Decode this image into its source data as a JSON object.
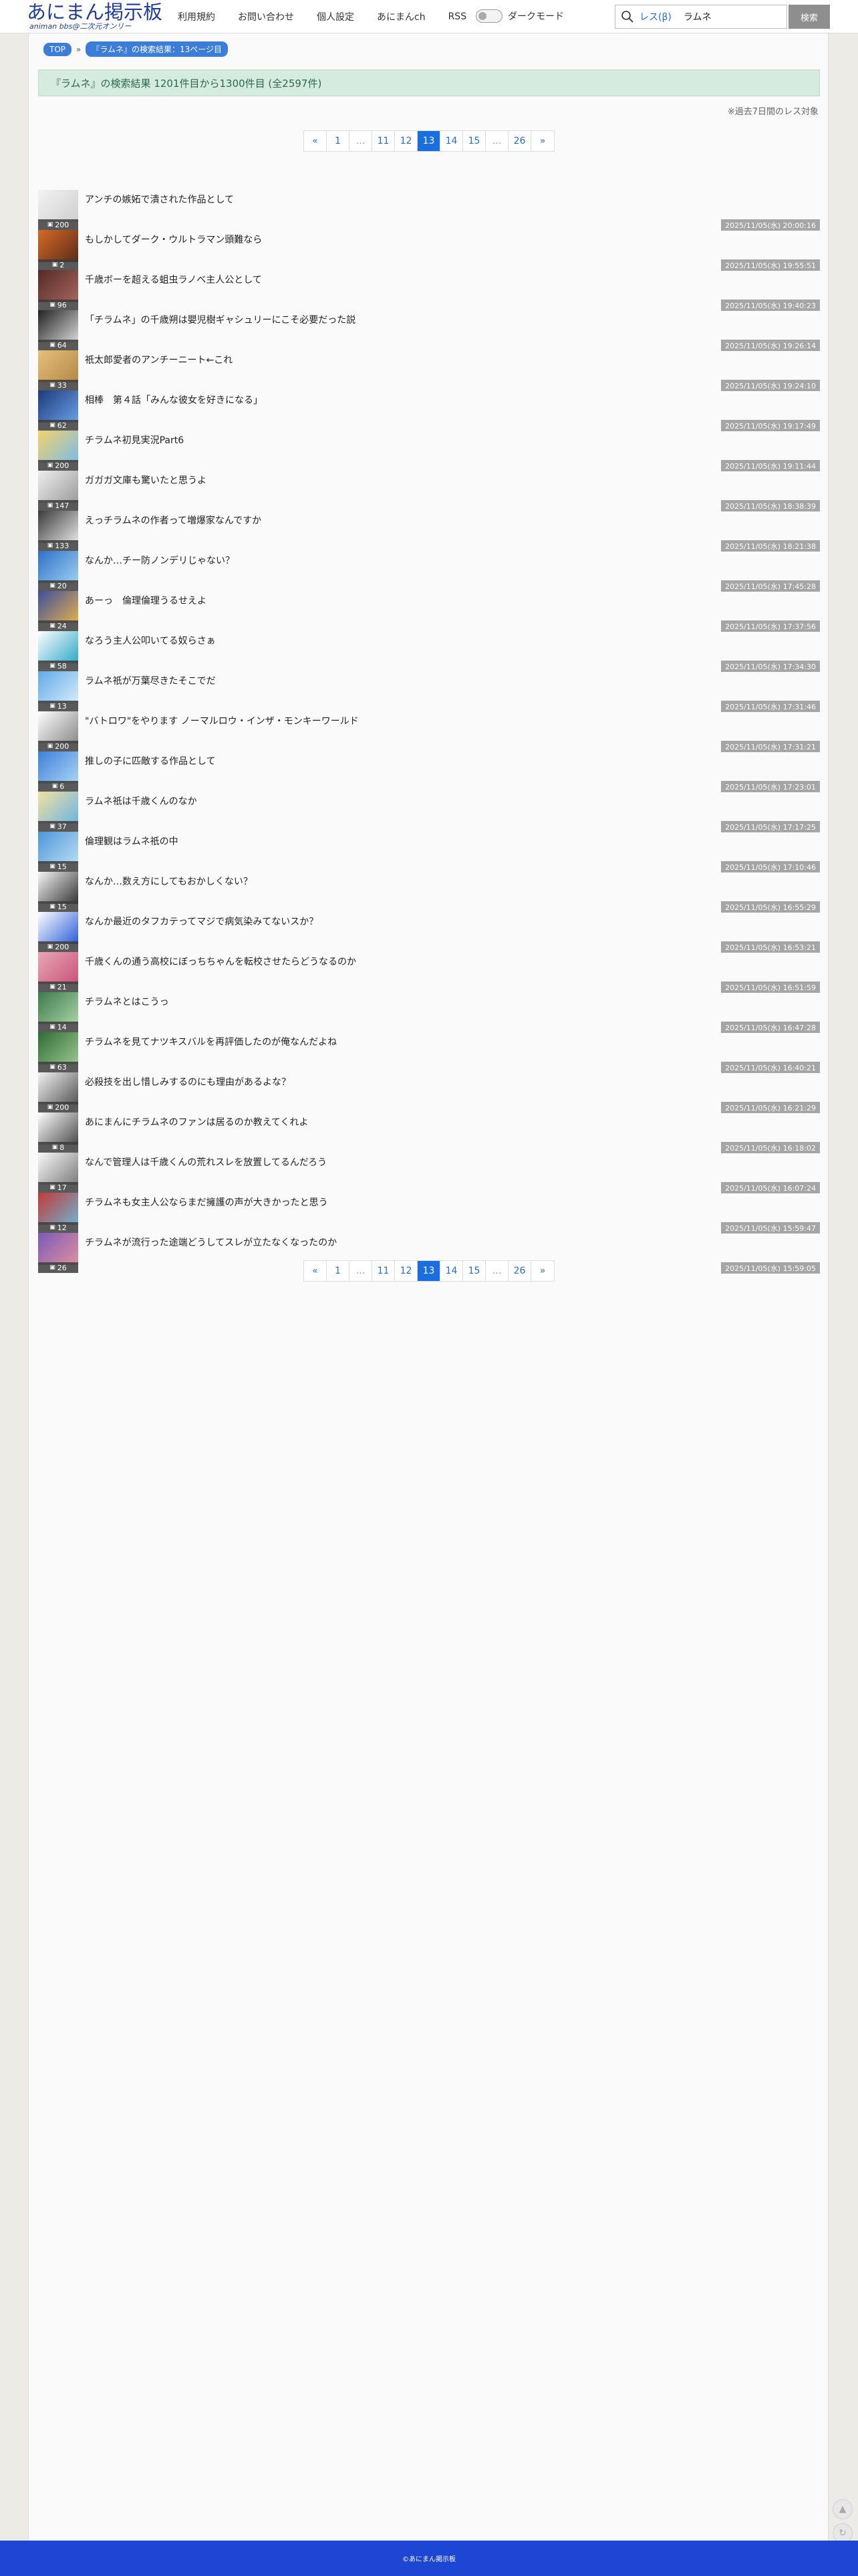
{
  "header": {
    "logo_main": "あにまん掲示板",
    "logo_sub": "animan bbs@二次元オンリー",
    "nav": [
      "利用規約",
      "お問い合わせ",
      "個人設定",
      "あにまんch",
      "RSS"
    ],
    "dark_mode_label": "ダークモード",
    "search_scope": "レス(β)",
    "search_value": "ラムネ",
    "search_button": "検索"
  },
  "breadcrumb": {
    "top": "TOP",
    "separator": "»",
    "current": "『ラムネ』の検索結果：13ページ目"
  },
  "result_banner": "『ラムネ』の検索結果 1201件目から1300件目 (全2597件)",
  "note": "※過去7日間のレス対象",
  "pager": {
    "prev": "«",
    "next": "»",
    "pages": [
      "1",
      "...",
      "11",
      "12",
      "13",
      "14",
      "15",
      "...",
      "26"
    ],
    "active": "13"
  },
  "threads": [
    {
      "title": "アンチの嫉妬で潰された作品として",
      "count": "200",
      "date": "2025/11/05(水) 20:00:16",
      "colors": [
        "#f2f2f2",
        "#cfcfcf"
      ]
    },
    {
      "title": "もしかしてダーク・ウルトラマン頭難なら",
      "count": "2",
      "date": "2025/11/05(水) 19:55:51",
      "colors": [
        "#d66a28",
        "#5a2b17"
      ]
    },
    {
      "title": "千歳ボーを超える蛆虫ラノベ主人公として",
      "count": "96",
      "date": "2025/11/05(水) 19:40:23",
      "colors": [
        "#552a27",
        "#a6655b"
      ]
    },
    {
      "title": "「チラムネ」の千歳朔は嬰児樹ギャシュリーにこそ必要だった説",
      "count": "64",
      "date": "2025/11/05(水) 19:26:14",
      "colors": [
        "#222222",
        "#d8d8d8"
      ]
    },
    {
      "title": "祇太郎愛者のアンチーニート←これ",
      "count": "33",
      "date": "2025/11/05(水) 19:24:10",
      "colors": [
        "#e5c07a",
        "#b48846"
      ]
    },
    {
      "title": "相棒　第４話「みんな彼女を好きになる」",
      "count": "62",
      "date": "2025/11/05(水) 19:17:49",
      "colors": [
        "#1e3a7c",
        "#6aa0e6"
      ]
    },
    {
      "title": "チラムネ初見実況Part6",
      "count": "200",
      "date": "2025/11/05(水) 19:11:44",
      "colors": [
        "#f4d36b",
        "#7bbbe6"
      ]
    },
    {
      "title": "ガガガ文庫も驚いたと思うよ",
      "count": "147",
      "date": "2025/11/05(水) 18:38:39",
      "colors": [
        "#ededed",
        "#9b9b9b"
      ]
    },
    {
      "title": "えっチラムネの作者って増爆家なんですか",
      "count": "133",
      "date": "2025/11/05(水) 18:21:38",
      "colors": [
        "#3b3b3b",
        "#e6e6e6"
      ]
    },
    {
      "title": "なんか…チー防ノンデリじゃない？",
      "count": "20",
      "date": "2025/11/05(水) 17:45:28",
      "colors": [
        "#2f6fc7",
        "#9dd0f1"
      ]
    },
    {
      "title": "あーっ　倫理倫理うるせえよ",
      "count": "24",
      "date": "2025/11/05(水) 17:37:56",
      "colors": [
        "#3d4f9e",
        "#e2b04b"
      ]
    },
    {
      "title": "なろう主人公叩いてる奴らさぁ",
      "count": "58",
      "date": "2025/11/05(水) 17:34:30",
      "colors": [
        "#ffffff",
        "#2ea7c9"
      ]
    },
    {
      "title": "ラムネ祇が万葉尽きたそこでだ",
      "count": "13",
      "date": "2025/11/05(水) 17:31:46",
      "colors": [
        "#62a9e8",
        "#d6ecfb"
      ]
    },
    {
      "title": "\"バトロワ\"をやります ノーマルロウ・インザ・モンキーワールド",
      "count": "200",
      "date": "2025/11/05(水) 17:31:21",
      "colors": [
        "#ffffff",
        "#888888"
      ]
    },
    {
      "title": "推しの子に匹敵する作品として",
      "count": "6",
      "date": "2025/11/05(水) 17:23:01",
      "colors": [
        "#3e7fd9",
        "#a9d5f5"
      ]
    },
    {
      "title": "ラムネ祇は千歳くんのなか",
      "count": "37",
      "date": "2025/11/05(水) 17:17:25",
      "colors": [
        "#f2e1a0",
        "#6cb4e2"
      ]
    },
    {
      "title": "倫理観はラムネ祇の中",
      "count": "15",
      "date": "2025/11/05(水) 17:10:46",
      "colors": [
        "#4d96d9",
        "#b9dcf3"
      ]
    },
    {
      "title": "なんか…数え方にしてもおかしくない？",
      "count": "15",
      "date": "2025/11/05(水) 16:55:29",
      "colors": [
        "#f6f6f6",
        "#333333"
      ]
    },
    {
      "title": "なんか最近のタフカテってマジで病気染みてないスか？",
      "count": "200",
      "date": "2025/11/05(水) 16:53:21",
      "colors": [
        "#ffffff",
        "#2a5bd7"
      ]
    },
    {
      "title": "千歳くんの通う高校にぼっちちゃんを転校させたらどうなるのか",
      "count": "21",
      "date": "2025/11/05(水) 16:51:59",
      "colors": [
        "#e9a7b4",
        "#c9527a"
      ]
    },
    {
      "title": "チラムネとはこうっ",
      "count": "14",
      "date": "2025/11/05(水) 16:47:28",
      "colors": [
        "#3f7a4d",
        "#a6d3a3"
      ]
    },
    {
      "title": "チラムネを見てナツキスバルを再評価したのが俺なんだよね",
      "count": "63",
      "date": "2025/11/05(水) 16:40:21",
      "colors": [
        "#2e6b36",
        "#9cc68f"
      ]
    },
    {
      "title": "必殺技を出し惜しみするのにも理由があるよな？",
      "count": "200",
      "date": "2025/11/05(水) 16:21:29",
      "colors": [
        "#f1f1f1",
        "#555555"
      ]
    },
    {
      "title": "あにまんにチラムネのファンは居るのか教えてくれよ",
      "count": "8",
      "date": "2025/11/05(水) 16:18:02",
      "colors": [
        "#ffffff",
        "#4a4a4a"
      ]
    },
    {
      "title": "なんで管理人は千歳くんの荒れスレを放置してるんだろう",
      "count": "17",
      "date": "2025/11/05(水) 16:07:24",
      "colors": [
        "#fafafa",
        "#7a7a7a"
      ]
    },
    {
      "title": "チラムネも女主人公ならまだ擁護の声が大きかったと思う",
      "count": "12",
      "date": "2025/11/05(水) 15:59:47",
      "colors": [
        "#c23a3a",
        "#6fb2cc"
      ]
    },
    {
      "title": "チラムネが流行った途端どうしてスレが立たなくなったのか",
      "count": "26",
      "date": "2025/11/05(水) 15:59:05",
      "colors": [
        "#7a5ab9",
        "#e08f9c"
      ]
    }
  ],
  "scroll_up": "▲",
  "scroll_down": "↻",
  "footer": "©あにまん掲示板"
}
